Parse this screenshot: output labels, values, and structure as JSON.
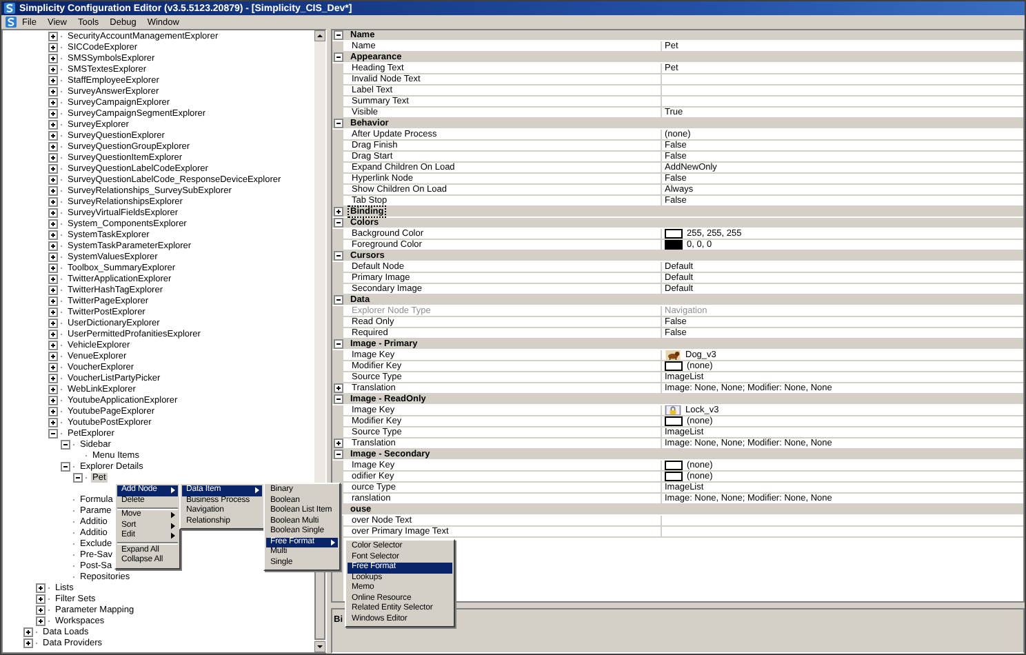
{
  "window": {
    "title": "Simplicity Configuration Editor (v3.5.5123.20879) - [Simplicity_CIS_Dev*]"
  },
  "menu_bar": [
    "File",
    "View",
    "Tools",
    "Debug",
    "Window"
  ],
  "tree": {
    "items": [
      {
        "children": [
          {
            "children": [
              {
                "label": "SecurityAccountManagementExplorer",
                "expanded": false,
                "selected": false
              },
              {
                "label": "SICCodeExplorer",
                "expanded": false,
                "selected": false
              },
              {
                "label": "SMSSymbolsExplorer",
                "expanded": false,
                "selected": false
              },
              {
                "label": "SMSTextesExplorer",
                "expanded": false,
                "selected": false
              },
              {
                "label": "StaffEmployeeExplorer",
                "expanded": false,
                "selected": false
              },
              {
                "label": "SurveyAnswerExplorer",
                "expanded": false,
                "selected": false
              },
              {
                "label": "SurveyCampaignExplorer",
                "expanded": false,
                "selected": false
              },
              {
                "label": "SurveyCampaignSegmentExplorer",
                "expanded": false,
                "selected": false
              },
              {
                "label": "SurveyExplorer",
                "expanded": false,
                "selected": false
              },
              {
                "label": "SurveyQuestionExplorer",
                "expanded": false,
                "selected": false
              },
              {
                "label": "SurveyQuestionGroupExplorer",
                "expanded": false,
                "selected": false
              },
              {
                "label": "SurveyQuestionItemExplorer",
                "expanded": false,
                "selected": false
              },
              {
                "label": "SurveyQuestionLabelCodeExplorer",
                "expanded": false,
                "selected": false
              },
              {
                "label": "SurveyQuestionLabelCode_ResponseDeviceExplorer",
                "expanded": false,
                "selected": false
              },
              {
                "label": "SurveyRelationships_SurveySubExplorer",
                "expanded": false,
                "selected": false
              },
              {
                "label": "SurveyRelationshipsExplorer",
                "expanded": false,
                "selected": false
              },
              {
                "label": "SurveyVirtualFieldsExplorer",
                "expanded": false,
                "selected": false
              },
              {
                "label": "System_ComponentsExplorer",
                "expanded": false,
                "selected": false
              },
              {
                "label": "SystemTaskExplorer",
                "expanded": false,
                "selected": false
              },
              {
                "label": "SystemTaskParameterExplorer",
                "expanded": false,
                "selected": false
              },
              {
                "label": "SystemValuesExplorer",
                "expanded": false,
                "selected": false
              },
              {
                "label": "Toolbox_SummaryExplorer",
                "expanded": false,
                "selected": false
              },
              {
                "label": "TwitterApplicationExplorer",
                "expanded": false,
                "selected": false
              },
              {
                "label": "TwitterHashTagExplorer",
                "expanded": false,
                "selected": false
              },
              {
                "label": "TwitterPageExplorer",
                "expanded": false,
                "selected": false
              },
              {
                "label": "TwitterPostExplorer",
                "expanded": false,
                "selected": false
              },
              {
                "label": "UserDictionaryExplorer",
                "expanded": false,
                "selected": false
              },
              {
                "label": "UserPermittedProfanitiesExplorer",
                "expanded": false,
                "selected": false
              },
              {
                "label": "VehicleExplorer",
                "expanded": false,
                "selected": false
              },
              {
                "label": "VenueExplorer",
                "expanded": false,
                "selected": false
              },
              {
                "label": "VoucherExplorer",
                "expanded": false,
                "selected": false
              },
              {
                "label": "VoucherListPartyPicker",
                "expanded": false,
                "selected": false
              },
              {
                "label": "WebLinkExplorer",
                "expanded": false,
                "selected": false
              },
              {
                "label": "YoutubeApplicationExplorer",
                "expanded": false,
                "selected": false
              },
              {
                "label": "YoutubePageExplorer",
                "expanded": false,
                "selected": false
              },
              {
                "label": "YoutubePostExplorer",
                "expanded": false,
                "selected": false
              },
              {
                "label": "PetExplorer",
                "expanded": true,
                "selected": false,
                "children": [
                  {
                    "label": "Sidebar",
                    "expanded": true,
                    "selected": false,
                    "children": [
                      {
                        "label": "Menu Items",
                        "selected": false
                      }
                    ]
                  },
                  {
                    "label": "Explorer Details",
                    "expanded": true,
                    "selected": false,
                    "children": [
                      {
                        "label": "Pet",
                        "expanded": true,
                        "selected": true
                      }
                    ]
                  },
                  {
                    "label": "Formula",
                    "selected": false
                  },
                  {
                    "label": "Parame",
                    "selected": false
                  },
                  {
                    "label": "Additio",
                    "selected": false
                  },
                  {
                    "label": "Additio",
                    "selected": false
                  },
                  {
                    "label": "Exclude",
                    "selected": false
                  },
                  {
                    "label": "Pre-Sav",
                    "selected": false
                  },
                  {
                    "label": "Post-Sa",
                    "selected": false
                  },
                  {
                    "label": "Repositories",
                    "selected": false
                  }
                ]
              }
            ]
          },
          {
            "label": "Lists",
            "expanded": false,
            "selected": false
          },
          {
            "label": "Filter Sets",
            "expanded": false,
            "selected": false
          },
          {
            "label": "Parameter Mapping",
            "expanded": false,
            "selected": false
          },
          {
            "label": "Workspaces",
            "expanded": false,
            "selected": false
          }
        ]
      },
      {
        "label": "Data Loads",
        "expanded": false,
        "selected": false
      },
      {
        "label": "Data Providers",
        "expanded": false,
        "selected": false
      }
    ]
  },
  "properties": {
    "categories": [
      {
        "label": "Name",
        "expanded": true,
        "selected": false,
        "rows": [
          {
            "label": "Name",
            "value": "Pet",
            "disabled": false
          }
        ]
      },
      {
        "label": "Appearance",
        "expanded": true,
        "selected": false,
        "rows": [
          {
            "label": "Heading Text",
            "value": "Pet",
            "disabled": false
          },
          {
            "label": "Invalid Node Text",
            "disabled": false
          },
          {
            "label": "Label Text",
            "disabled": false
          },
          {
            "label": "Summary Text",
            "disabled": false
          },
          {
            "label": "Visible",
            "value": "True",
            "disabled": false
          }
        ]
      },
      {
        "label": "Behavior",
        "expanded": true,
        "selected": false,
        "rows": [
          {
            "label": "After Update Process",
            "value": "(none)",
            "disabled": false
          },
          {
            "label": "Drag Finish",
            "value": "False",
            "disabled": false
          },
          {
            "label": "Drag Start",
            "value": "False",
            "disabled": false
          },
          {
            "label": "Expand Children On Load",
            "value": "AddNewOnly",
            "disabled": false
          },
          {
            "label": "Hyperlink Node",
            "value": "False",
            "disabled": false
          },
          {
            "label": "Show Children On Load",
            "value": "Always",
            "disabled": false
          },
          {
            "label": "Tab Stop",
            "value": "False",
            "disabled": false
          }
        ]
      },
      {
        "label": "Binding",
        "expanded": false,
        "selected": true
      },
      {
        "label": "Colors",
        "expanded": true,
        "selected": false,
        "rows": [
          {
            "label": "Background Color",
            "value": "255, 255, 255",
            "kind": "swatch",
            "color": "#ffffff",
            "disabled": false
          },
          {
            "label": "Foreground Color",
            "value": "0, 0, 0",
            "kind": "swatch",
            "color": "#000000",
            "disabled": false
          }
        ]
      },
      {
        "label": "Cursors",
        "expanded": true,
        "selected": false,
        "rows": [
          {
            "label": "Default Node",
            "value": "Default",
            "disabled": false
          },
          {
            "label": "Primary Image",
            "value": "Default",
            "disabled": false
          },
          {
            "label": "Secondary Image",
            "value": "Default",
            "disabled": false
          }
        ]
      },
      {
        "label": "Data",
        "expanded": true,
        "selected": false,
        "rows": [
          {
            "label": "Explorer Node Type",
            "value": "Navigation",
            "disabled": true
          },
          {
            "label": "Read Only",
            "value": "False",
            "disabled": false
          },
          {
            "label": "Required",
            "value": "False",
            "disabled": false
          }
        ]
      },
      {
        "label": "Image - Primary",
        "expanded": true,
        "selected": false,
        "rows": [
          {
            "label": "Image Key",
            "value": "Dog_v3",
            "kind": "dog",
            "disabled": false
          },
          {
            "label": "Modifier Key",
            "value": "(none)",
            "kind": "swatch",
            "color": "#ffffff",
            "disabled": false
          },
          {
            "label": "Source Type",
            "value": "ImageList",
            "disabled": false
          },
          {
            "label": "Translation",
            "value": "Image: None, None; Modifier: None, None",
            "expanded": false,
            "disabled": false
          }
        ]
      },
      {
        "label": "Image - ReadOnly",
        "expanded": true,
        "selected": false,
        "rows": [
          {
            "label": "Image Key",
            "value": "Lock_v3",
            "kind": "lock",
            "disabled": false
          },
          {
            "label": "Modifier Key",
            "value": "(none)",
            "kind": "swatch",
            "color": "#ffffff",
            "disabled": false
          },
          {
            "label": "Source Type",
            "value": "ImageList",
            "disabled": false
          },
          {
            "label": "Translation",
            "value": "Image: None, None; Modifier: None, None",
            "expanded": false,
            "disabled": false
          }
        ]
      },
      {
        "label": "Image - Secondary",
        "expanded": true,
        "selected": false,
        "rows": [
          {
            "label": "Image Key",
            "value": "(none)",
            "kind": "swatch",
            "color": "#ffffff",
            "disabled": false
          },
          {
            "label": "odifier Key",
            "value": "(none)",
            "kind": "swatch",
            "color": "#ffffff",
            "disabled": false
          },
          {
            "label": "ource Type",
            "value": "ImageList",
            "disabled": false
          },
          {
            "label": "ranslation",
            "value": "Image: None, None; Modifier: None, None",
            "disabled": false
          }
        ]
      },
      {
        "label": "ouse",
        "selected": false,
        "rows": [
          {
            "label": "over Node Text",
            "disabled": false
          },
          {
            "label": "over Primary Image Text",
            "disabled": false
          }
        ]
      }
    ]
  },
  "description": {
    "title": "Bi"
  },
  "menus": [
    {
      "groups": [
        {
          "items": [
            {
              "label": "Add Node",
              "submenu": true,
              "selected": true
            },
            {
              "label": "Delete",
              "submenu": false,
              "selected": false
            }
          ]
        },
        {
          "items": [
            {
              "label": "Move",
              "submenu": true,
              "selected": false
            },
            {
              "label": "Sort",
              "submenu": true,
              "selected": false
            },
            {
              "label": "Edit",
              "submenu": true,
              "selected": false
            }
          ]
        },
        {
          "items": [
            {
              "label": "Expand All",
              "submenu": false,
              "selected": false
            },
            {
              "label": "Collapse All",
              "submenu": false,
              "selected": false
            }
          ]
        }
      ]
    },
    {
      "groups": [
        {
          "items": [
            {
              "label": "Data Item",
              "submenu": true,
              "selected": true
            },
            {
              "label": "Business Process",
              "submenu": false,
              "selected": false
            },
            {
              "label": "Navigation",
              "submenu": false,
              "selected": false
            },
            {
              "label": "Relationship",
              "submenu": false,
              "selected": false
            }
          ]
        }
      ]
    },
    {
      "groups": [
        {
          "items": [
            {
              "label": "Binary",
              "submenu": false,
              "selected": false
            },
            {
              "label": "Boolean",
              "submenu": false,
              "selected": false
            },
            {
              "label": "Boolean List Item",
              "submenu": false,
              "selected": false
            },
            {
              "label": "Boolean Multi",
              "submenu": false,
              "selected": false
            },
            {
              "label": "Boolean Single",
              "submenu": false,
              "selected": false
            },
            {
              "label": "Free Format",
              "submenu": true,
              "selected": true
            },
            {
              "label": "Multi",
              "submenu": false,
              "selected": false
            },
            {
              "label": "Single",
              "submenu": false,
              "selected": false
            }
          ]
        }
      ]
    },
    {
      "groups": [
        {
          "items": [
            {
              "label": "Color Selector",
              "submenu": false,
              "selected": false
            },
            {
              "label": "Font Selector",
              "submenu": false,
              "selected": false
            },
            {
              "label": "Free Format",
              "submenu": false,
              "selected": true
            },
            {
              "label": "Lookups",
              "submenu": false,
              "selected": false
            },
            {
              "label": "Memo",
              "submenu": false,
              "selected": false
            },
            {
              "label": "Online Resource",
              "submenu": false,
              "selected": false
            },
            {
              "label": "Related Entity Selector",
              "submenu": false,
              "selected": false
            },
            {
              "label": "Windows Editor",
              "submenu": false,
              "selected": false
            }
          ]
        }
      ]
    }
  ]
}
